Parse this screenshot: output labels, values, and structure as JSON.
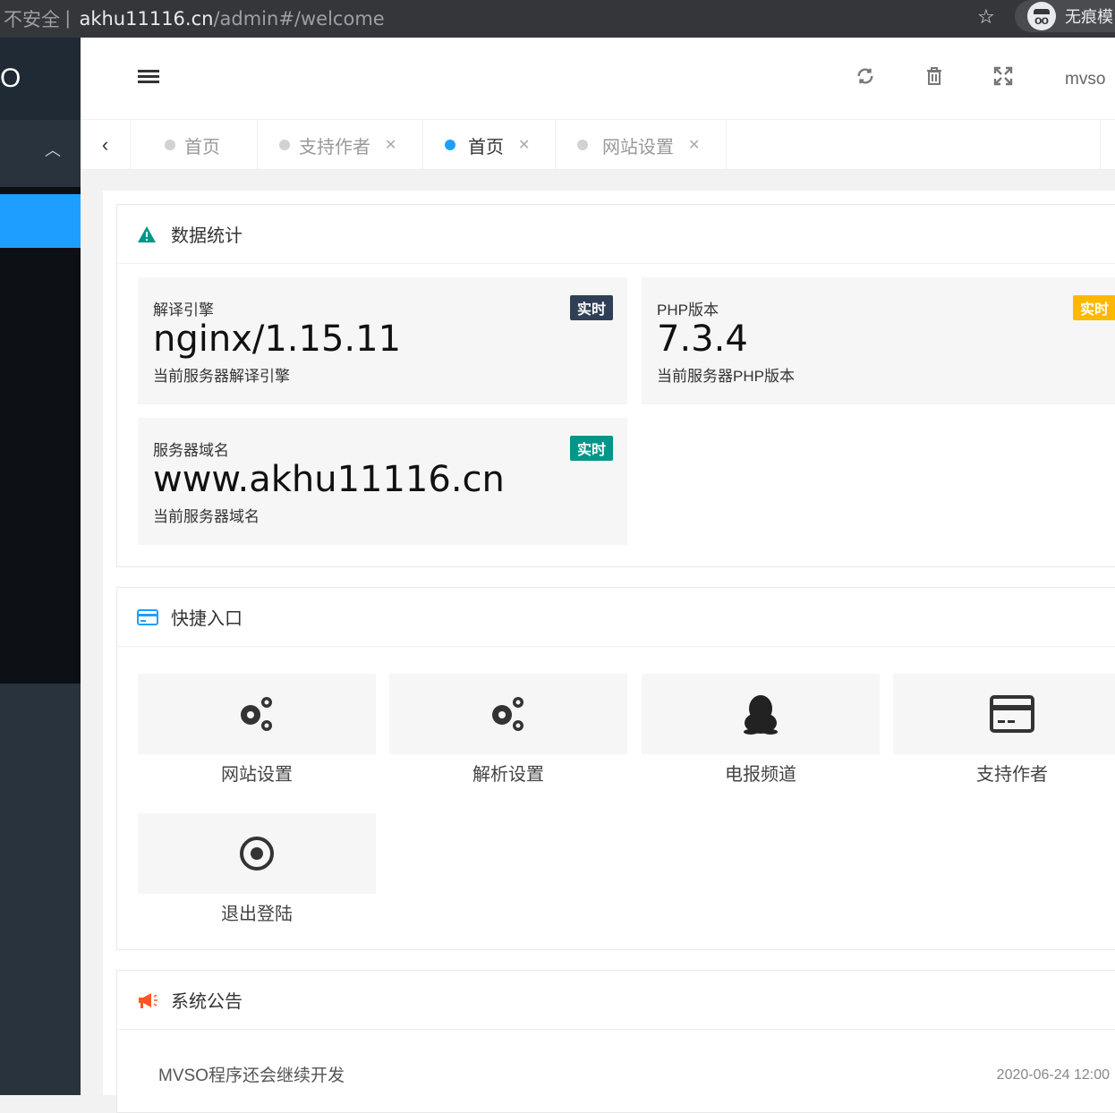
{
  "browser": {
    "security": "不安全",
    "separator": "|",
    "url_host": "akhu11116.cn",
    "url_path": "/admin#/welcome",
    "incognito_label": "无痕模"
  },
  "sidebar": {
    "logo": "O"
  },
  "header": {
    "user": "mvso"
  },
  "tabs": [
    {
      "label": "首页",
      "closable": false,
      "active": false
    },
    {
      "label": "支持作者",
      "closable": true,
      "active": false
    },
    {
      "label": "首页",
      "closable": true,
      "active": true
    },
    {
      "label": "网站设置",
      "closable": true,
      "active": false
    }
  ],
  "stats_card": {
    "title": "数据统计",
    "items": [
      {
        "title": "解译引擎",
        "value": "nginx/1.15.11",
        "desc": "当前服务器解译引擎",
        "badge": "实时",
        "badge_color": "#2f4056"
      },
      {
        "title": "PHP版本",
        "value": "7.3.4",
        "desc": "当前服务器PHP版本",
        "badge": "实时",
        "badge_color": "#ffb800"
      },
      {
        "title": "服务器域名",
        "value": "www.akhu11116.cn",
        "desc": "当前服务器域名",
        "badge": "实时",
        "badge_color": "#009688"
      }
    ]
  },
  "quick_card": {
    "title": "快捷入口",
    "items": [
      {
        "label": "网站设置",
        "icon": "gears-icon"
      },
      {
        "label": "解析设置",
        "icon": "gears-icon"
      },
      {
        "label": "电报频道",
        "icon": "qq-penguin-icon"
      },
      {
        "label": "支持作者",
        "icon": "credit-card-icon"
      },
      {
        "label": "退出登陆",
        "icon": "target-icon"
      }
    ]
  },
  "notice_card": {
    "title": "系统公告",
    "items": [
      {
        "text": "MVSO程序还会继续开发",
        "date": "2020-06-24 12:00"
      }
    ]
  },
  "colors": {
    "accent": "#1e9fff",
    "sidebar_bg": "#28333e",
    "warning_icon": "#009688",
    "notice_icon": "#ff5722"
  }
}
